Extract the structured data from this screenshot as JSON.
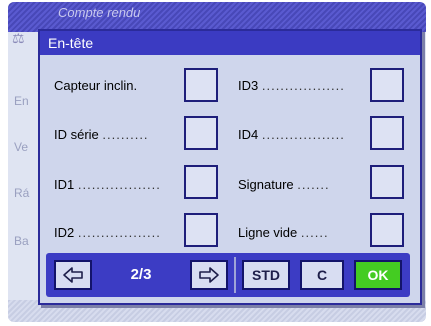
{
  "background": {
    "title": "Compte rendu",
    "side_labels": [
      "En",
      "Ve",
      "Rá",
      "Ba"
    ]
  },
  "dialog": {
    "title": "En-tête",
    "left_rows": [
      {
        "label": "Capteur inclin.",
        "dots": ""
      },
      {
        "label": "ID série",
        "dots": ".........."
      },
      {
        "label": "ID1",
        "dots": ".................."
      },
      {
        "label": "ID2",
        "dots": ".................."
      }
    ],
    "right_rows": [
      {
        "label": "ID3",
        "dots": ".................."
      },
      {
        "label": "ID4",
        "dots": ".................."
      },
      {
        "label": "Signature",
        "dots": "......."
      },
      {
        "label": "Ligne vide",
        "dots": "......"
      }
    ],
    "footer": {
      "prev_icon": "arrow-left-icon",
      "page": "2/3",
      "next_icon": "arrow-right-icon",
      "std_label": "STD",
      "c_label": "C",
      "ok_label": "OK"
    }
  },
  "colors": {
    "title_bar": "#3b3bc2",
    "ok_button": "#44cc22"
  }
}
